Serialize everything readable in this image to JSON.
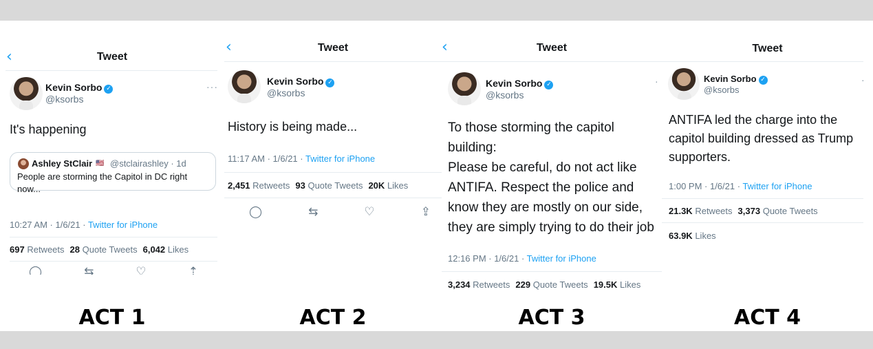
{
  "tweets": [
    {
      "act_label": "ACT 1",
      "header": "Tweet",
      "name": "Kevin Sorbo",
      "handle": "@ksorbs",
      "body": "It's happening",
      "quote": {
        "name": "Ashley StClair",
        "flag": "🇺🇸",
        "handle": "@stclairashley · 1d",
        "text": "People are storming the Capitol in DC right now..."
      },
      "time": "10:27 AM · 1/6/21 · ",
      "source": "Twitter for iPhone",
      "retweets": "697",
      "retweets_label": "Retweets",
      "quotes": "28",
      "quotes_label": "Quote Tweets",
      "likes": "6,042",
      "likes_label": "Likes"
    },
    {
      "act_label": "ACT 2",
      "header": "Tweet",
      "name": "Kevin Sorbo",
      "handle": "@ksorbs",
      "body": "History is being made...",
      "time": "11:17 AM · 1/6/21 · ",
      "source": "Twitter for iPhone",
      "retweets": "2,451",
      "retweets_label": "Retweets",
      "quotes": "93",
      "quotes_label": "Quote Tweets",
      "likes": "20K",
      "likes_label": "Likes"
    },
    {
      "act_label": "ACT 3",
      "header": "Tweet",
      "name": "Kevin Sorbo",
      "handle": "@ksorbs",
      "body": "To those storming the capitol building:\nPlease be careful, do not act like ANTIFA. Respect the police and know they are mostly on our side, they are simply trying to do their job",
      "time": "12:16 PM · 1/6/21 · ",
      "source": "Twitter for iPhone",
      "retweets": "3,234",
      "retweets_label": "Retweets",
      "quotes": "229",
      "quotes_label": "Quote Tweets",
      "likes": "19.5K",
      "likes_label": "Likes"
    },
    {
      "act_label": "ACT 4",
      "header": "Tweet",
      "name": "Kevin Sorbo",
      "handle": "@ksorbs",
      "body": "ANTIFA led the charge into the capitol building dressed as Trump supporters.",
      "time": "1:00 PM · 1/6/21 · ",
      "source": "Twitter for iPhone",
      "retweets": "21.3K",
      "retweets_label": "Retweets",
      "quotes": "3,373",
      "quotes_label": "Quote Tweets",
      "likes": "63.9K",
      "likes_label": "Likes"
    }
  ],
  "icons": {
    "back": "chevron-left-icon",
    "verified": "verified-badge-icon",
    "more": "more-options-icon",
    "reply": "reply-icon",
    "retweet": "retweet-icon",
    "like": "heart-icon",
    "share": "share-icon"
  },
  "colors": {
    "accent": "#1da1f2",
    "secondary_text": "#657786",
    "divider": "#e6ecf0",
    "band": "#d9d9d9"
  }
}
